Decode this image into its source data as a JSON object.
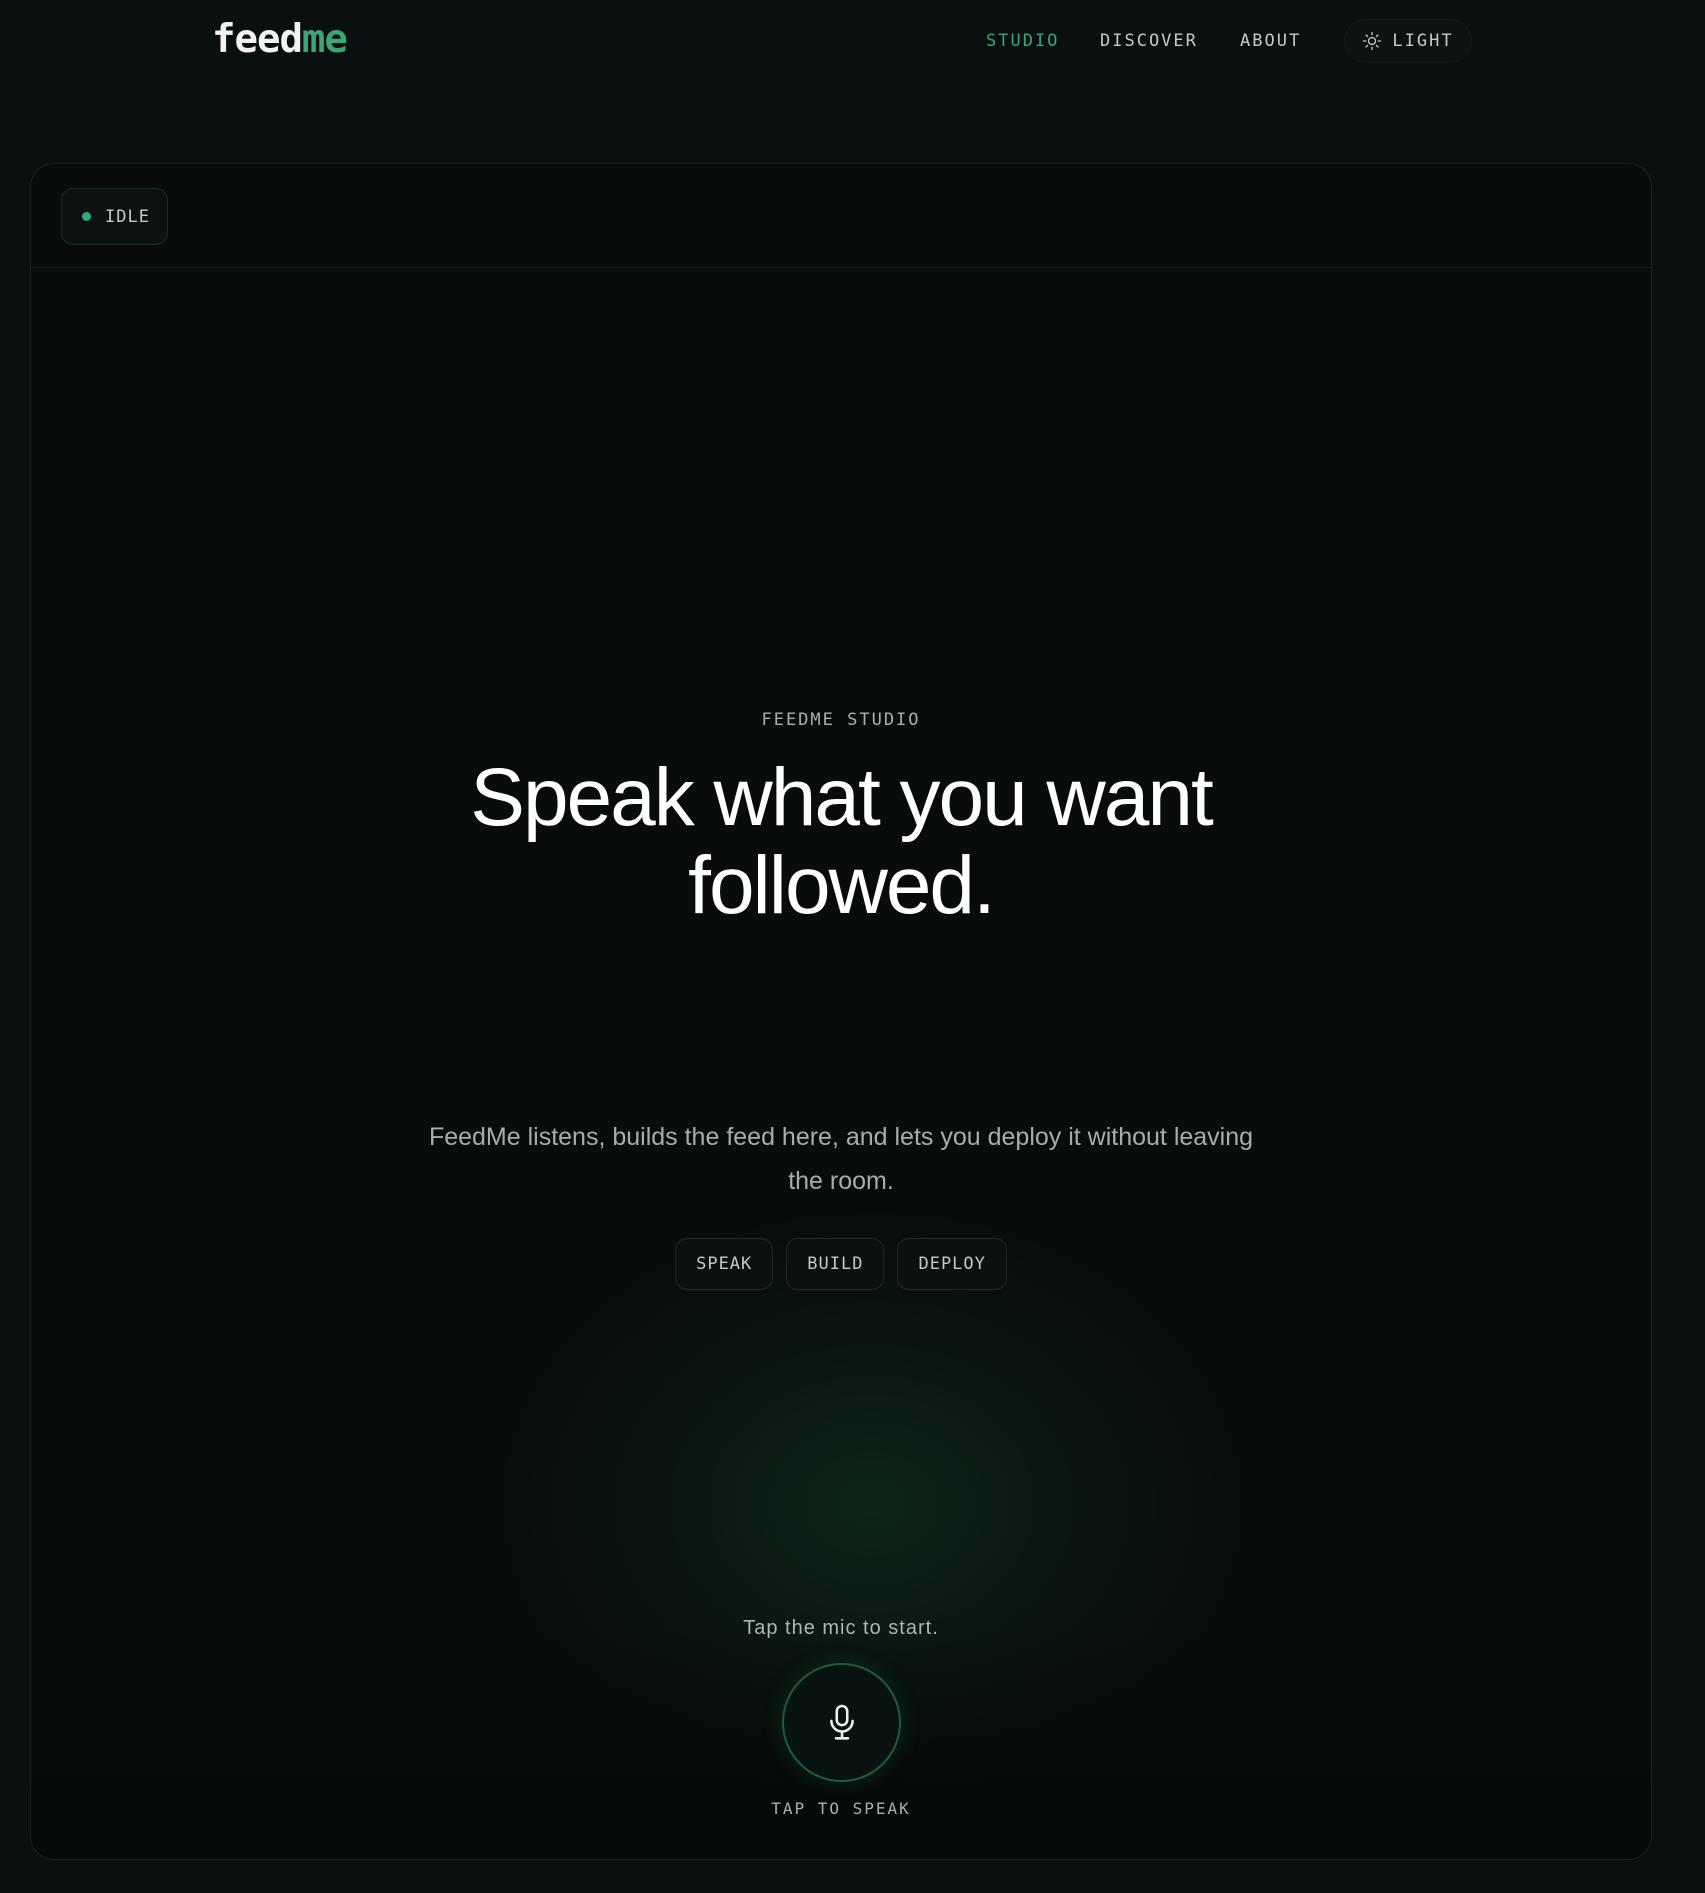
{
  "brand": {
    "logo_part1": "feed",
    "logo_part2": "me",
    "accent_color": "#3aa577"
  },
  "nav": {
    "items": [
      {
        "label": "STUDIO",
        "active": true
      },
      {
        "label": "DISCOVER",
        "active": false
      },
      {
        "label": "ABOUT",
        "active": false
      }
    ],
    "theme_toggle": {
      "label": "LIGHT",
      "icon": "sun-icon"
    }
  },
  "status": {
    "label": "IDLE",
    "dot_color": "#2fae79"
  },
  "hero": {
    "eyebrow": "FEEDME STUDIO",
    "headline_line1": "Speak what you want",
    "headline_line2": "followed.",
    "subtext_line1": "FeedMe listens, builds the feed here, and lets you deploy it without leaving",
    "subtext_line2": "the room.",
    "chips": [
      {
        "label": "SPEAK"
      },
      {
        "label": "BUILD"
      },
      {
        "label": "DEPLOY"
      }
    ]
  },
  "mic": {
    "hint": "Tap the mic to start.",
    "caption": "TAP TO SPEAK",
    "icon": "microphone-icon"
  }
}
